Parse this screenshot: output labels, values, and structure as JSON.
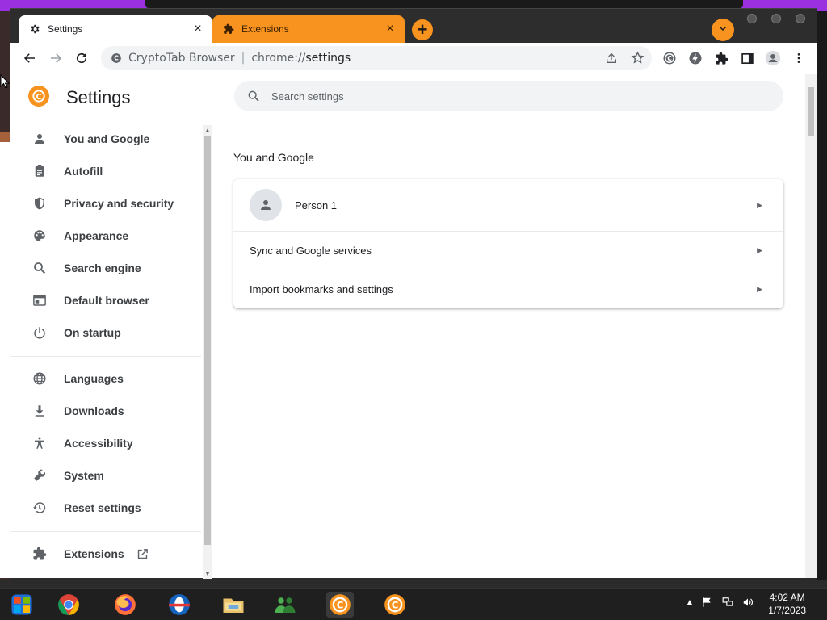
{
  "tabs": [
    {
      "label": "Settings",
      "icon": "gear-icon",
      "close": "×"
    },
    {
      "label": "Extensions",
      "icon": "puzzle-icon",
      "close": "×"
    }
  ],
  "new_tab": "+",
  "address": {
    "site": "CryptoTab Browser",
    "scheme": "chrome://",
    "path": "settings"
  },
  "page": {
    "title": "Settings",
    "search_placeholder": "Search settings"
  },
  "sidebar": {
    "items": [
      {
        "label": "You and Google",
        "icon": "person-icon"
      },
      {
        "label": "Autofill",
        "icon": "clipboard-icon"
      },
      {
        "label": "Privacy and security",
        "icon": "shield-icon"
      },
      {
        "label": "Appearance",
        "icon": "palette-icon"
      },
      {
        "label": "Search engine",
        "icon": "search-icon"
      },
      {
        "label": "Default browser",
        "icon": "browser-icon"
      },
      {
        "label": "On startup",
        "icon": "power-icon"
      },
      {
        "label": "Languages",
        "icon": "globe-icon"
      },
      {
        "label": "Downloads",
        "icon": "download-icon"
      },
      {
        "label": "Accessibility",
        "icon": "accessibility-icon"
      },
      {
        "label": "System",
        "icon": "wrench-icon"
      },
      {
        "label": "Reset settings",
        "icon": "history-icon"
      },
      {
        "label": "Extensions",
        "icon": "puzzle-icon"
      }
    ]
  },
  "main": {
    "section_title": "You and Google",
    "rows": [
      {
        "label": "Person 1"
      },
      {
        "label": "Sync and Google services"
      },
      {
        "label": "Import bookmarks and settings"
      }
    ]
  },
  "taskbar": {
    "time": "4:02 AM",
    "date": "1/7/2023"
  },
  "colors": {
    "accent": "#f7931e",
    "tabstrip": "#2d2d2d"
  }
}
